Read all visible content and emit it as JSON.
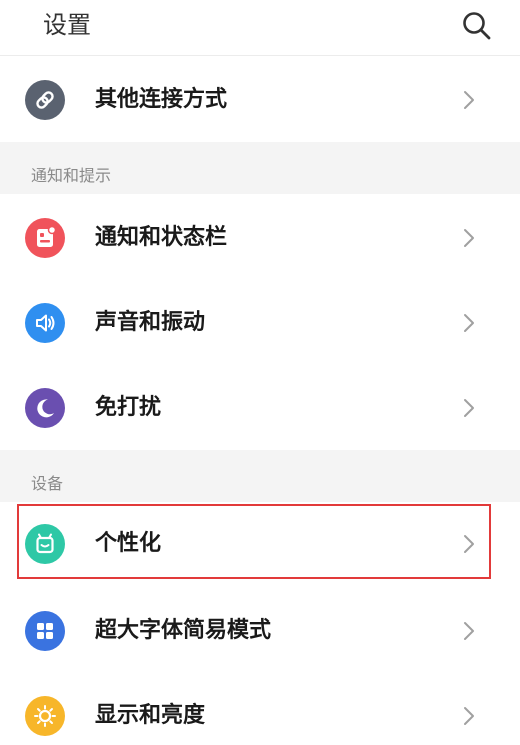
{
  "header": {
    "title": "设置",
    "search_icon": "search-icon"
  },
  "rows": {
    "other_connection": {
      "label": "其他连接方式",
      "icon": "link-icon",
      "color": "#5a6270"
    },
    "notification_bar": {
      "label": "通知和状态栏",
      "icon": "notification-icon",
      "color": "#f0535b"
    },
    "sound_vibration": {
      "label": "声音和振动",
      "icon": "speaker-icon",
      "color": "#2f8ff0"
    },
    "do_not_disturb": {
      "label": "免打扰",
      "icon": "moon-icon",
      "color": "#6a4fb0"
    },
    "personalization": {
      "label": "个性化",
      "icon": "theme-icon",
      "color": "#2ec8a6"
    },
    "large_font": {
      "label": "超大字体简易模式",
      "icon": "grid-icon",
      "color": "#3a73e0"
    },
    "display_brightness": {
      "label": "显示和亮度",
      "icon": "sun-icon",
      "color": "#f7b62a"
    }
  },
  "sections": {
    "notifications": "通知和提示",
    "device": "设备"
  },
  "colors": {
    "highlight": "#e23a3a",
    "section_bg": "#f4f4f4"
  }
}
